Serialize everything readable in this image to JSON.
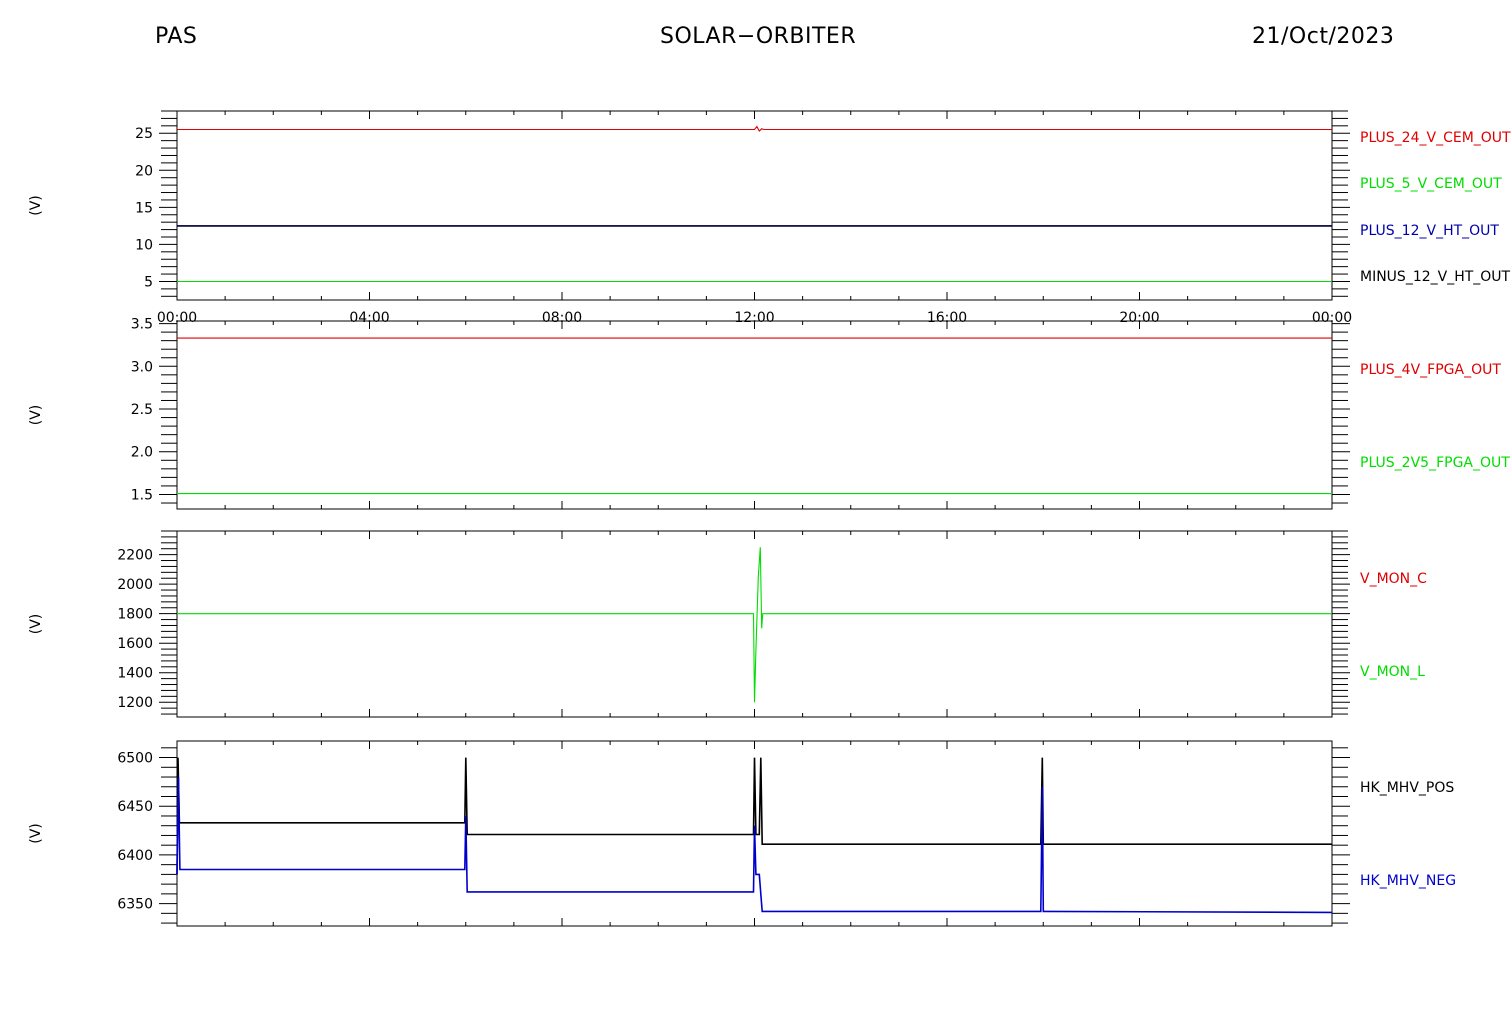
{
  "header": {
    "left": "PAS",
    "center": "SOLAR−ORBITER",
    "right": "21/Oct/2023"
  },
  "chart_data": [
    {
      "type": "line",
      "ylabel": "(V)",
      "ylim": [
        2.5,
        28
      ],
      "yticks": [
        5,
        10,
        15,
        20,
        25
      ],
      "xlim": [
        0,
        24
      ],
      "xticklabels": [
        "00:00",
        "04:00",
        "08:00",
        "12:00",
        "16:00",
        "20:00",
        "00:00"
      ],
      "series": [
        {
          "name": "PLUS_24_V_CEM_OUT",
          "color": "#e00000",
          "x": [
            0,
            12.0,
            12.05,
            12.1,
            12.15,
            12.2,
            24
          ],
          "y": [
            25.5,
            25.5,
            25.9,
            25.3,
            25.6,
            25.5,
            25.5
          ]
        },
        {
          "name": "PLUS_5_V_CEM_OUT",
          "color": "#00dd00",
          "x": [
            0,
            24
          ],
          "y": [
            5.0,
            5.0
          ]
        },
        {
          "name": "PLUS_12_V_HT_OUT",
          "color": "#0000aa",
          "x": [
            0,
            24
          ],
          "y": [
            12.5,
            12.5
          ]
        },
        {
          "name": "MINUS_12_V_HT_OUT",
          "color": "#000000",
          "x": [
            0,
            24
          ],
          "y": [
            12.5,
            12.5
          ]
        }
      ]
    },
    {
      "type": "line",
      "ylabel": "(V)",
      "ylim": [
        1.33,
        3.53
      ],
      "yticks": [
        1.5,
        2.0,
        2.5,
        3.0,
        3.5
      ],
      "yticklabels": [
        "1.5",
        "2.0",
        "2.5",
        "3.0",
        "3.5"
      ],
      "xlim": [
        0,
        24
      ],
      "series": [
        {
          "name": "PLUS_4V_FPGA_OUT",
          "color": "#e00000",
          "x": [
            0,
            24
          ],
          "y": [
            3.33,
            3.33
          ]
        },
        {
          "name": "PLUS_2V5_FPGA_OUT",
          "color": "#00dd00",
          "x": [
            0,
            24
          ],
          "y": [
            1.51,
            1.51
          ]
        }
      ]
    },
    {
      "type": "line",
      "ylabel": "(V)",
      "ylim": [
        1100,
        2360
      ],
      "yticks": [
        1200,
        1400,
        1600,
        1800,
        2000,
        2200
      ],
      "xlim": [
        0,
        24
      ],
      "series": [
        {
          "name": "V_MON_C",
          "color": "#e00000",
          "x": [],
          "y": []
        },
        {
          "name": "V_MON_L",
          "color": "#00dd00",
          "x": [
            0,
            11.98,
            12.0,
            12.03,
            12.08,
            12.12,
            12.15,
            12.17,
            12.2,
            24
          ],
          "y": [
            1800,
            1800,
            1200,
            1550,
            2050,
            2250,
            1700,
            1800,
            1800,
            1800
          ]
        }
      ]
    },
    {
      "type": "line",
      "ylabel": "(V)",
      "ylim": [
        6327,
        6517
      ],
      "yticks": [
        6350,
        6400,
        6450,
        6500
      ],
      "xlim": [
        0,
        24
      ],
      "series": [
        {
          "name": "HK_MHV_POS",
          "color": "#000000",
          "x": [
            0,
            0.02,
            0.05,
            0.08,
            5.98,
            6.0,
            6.03,
            6.06,
            11.98,
            12.0,
            12.03,
            12.1,
            12.13,
            12.16,
            17.95,
            17.98,
            18.0,
            18.03,
            24
          ],
          "y": [
            6380,
            6500,
            6433,
            6433,
            6433,
            6500,
            6421,
            6421,
            6421,
            6500,
            6421,
            6421,
            6500,
            6411,
            6411,
            6500,
            6411,
            6411,
            6411
          ]
        },
        {
          "name": "HK_MHV_NEG",
          "color": "#0000cc",
          "x": [
            0,
            0.03,
            0.06,
            0.1,
            5.98,
            6.0,
            6.03,
            6.06,
            11.98,
            12.0,
            12.03,
            12.1,
            12.13,
            12.16,
            17.95,
            17.98,
            18.0,
            18.03,
            24
          ],
          "y": [
            6380,
            6480,
            6385,
            6385,
            6385,
            6440,
            6362,
            6362,
            6362,
            6430,
            6380,
            6380,
            6360,
            6342,
            6342,
            6470,
            6342,
            6342,
            6341
          ]
        }
      ]
    }
  ]
}
